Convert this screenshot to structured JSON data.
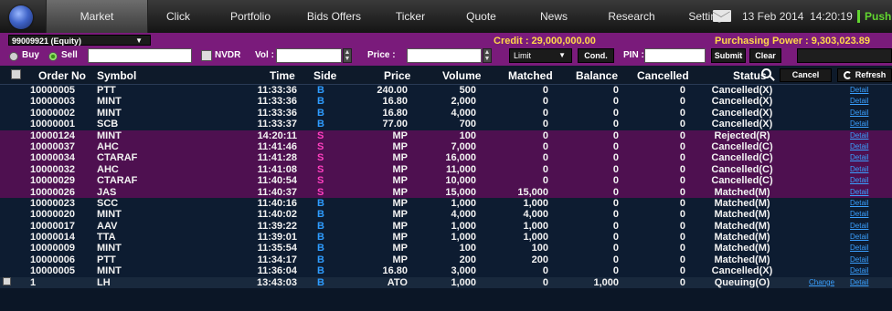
{
  "menu": [
    {
      "label": "Market",
      "active": true
    },
    {
      "label": "Click"
    },
    {
      "label": "Portfolio"
    },
    {
      "label": "Bids Offers"
    },
    {
      "label": "Ticker"
    },
    {
      "label": "Quote"
    },
    {
      "label": "News"
    },
    {
      "label": "Research"
    },
    {
      "label": "Settings"
    }
  ],
  "header": {
    "date": "13 Feb 2014",
    "time": "14:20:19",
    "push_label": "Push"
  },
  "order_bar": {
    "account": "99009921 (Equity)",
    "credit": "Credit : 29,000,000.00",
    "purchasing_power": "Purchasing Power : 9,303,023.89",
    "buy_label": "Buy",
    "sell_label": "Sell",
    "sell_selected": true,
    "symbol_value": "",
    "nvdr_label": "NVDR",
    "vol_label": "Vol :",
    "vol_value": "",
    "price_label": "Price :",
    "price_value": "",
    "order_type": "Limit",
    "cond_label": "Cond.",
    "pin_label": "PIN :",
    "pin_value": "",
    "submit_label": "Submit",
    "clear_label": "Clear"
  },
  "table": {
    "columns": {
      "order_no": "Order No",
      "symbol": "Symbol",
      "time": "Time",
      "side": "Side",
      "price": "Price",
      "volume": "Volume",
      "matched": "Matched",
      "balance": "Balance",
      "cancelled": "Cancelled",
      "status": "Status"
    },
    "cancel_label": "Cancel",
    "refresh_label": "Refresh",
    "detail_label": "Detail",
    "change_label": "Change",
    "rows": [
      {
        "order_no": "10000005",
        "symbol": "PTT",
        "time": "11:33:36",
        "side": "B",
        "price": "240.00",
        "volume": "500",
        "matched": "0",
        "balance": "0",
        "cancelled": "0",
        "status": "Cancelled(X)"
      },
      {
        "order_no": "10000003",
        "symbol": "MINT",
        "time": "11:33:36",
        "side": "B",
        "price": "16.80",
        "volume": "2,000",
        "matched": "0",
        "balance": "0",
        "cancelled": "0",
        "status": "Cancelled(X)"
      },
      {
        "order_no": "10000002",
        "symbol": "MINT",
        "time": "11:33:36",
        "side": "B",
        "price": "16.80",
        "volume": "4,000",
        "matched": "0",
        "balance": "0",
        "cancelled": "0",
        "status": "Cancelled(X)"
      },
      {
        "order_no": "10000001",
        "symbol": "SCB",
        "time": "11:33:37",
        "side": "B",
        "price": "77.00",
        "volume": "700",
        "matched": "0",
        "balance": "0",
        "cancelled": "0",
        "status": "Cancelled(X)"
      },
      {
        "order_no": "10000124",
        "symbol": "MINT",
        "time": "14:20:11",
        "side": "S",
        "price": "MP",
        "volume": "100",
        "matched": "0",
        "balance": "0",
        "cancelled": "0",
        "status": "Rejected(R)"
      },
      {
        "order_no": "10000037",
        "symbol": "AHC",
        "time": "11:41:46",
        "side": "S",
        "price": "MP",
        "volume": "7,000",
        "matched": "0",
        "balance": "0",
        "cancelled": "0",
        "status": "Cancelled(C)"
      },
      {
        "order_no": "10000034",
        "symbol": "CTARAF",
        "time": "11:41:28",
        "side": "S",
        "price": "MP",
        "volume": "16,000",
        "matched": "0",
        "balance": "0",
        "cancelled": "0",
        "status": "Cancelled(C)"
      },
      {
        "order_no": "10000032",
        "symbol": "AHC",
        "time": "11:41:08",
        "side": "S",
        "price": "MP",
        "volume": "11,000",
        "matched": "0",
        "balance": "0",
        "cancelled": "0",
        "status": "Cancelled(C)"
      },
      {
        "order_no": "10000029",
        "symbol": "CTARAF",
        "time": "11:40:54",
        "side": "S",
        "price": "MP",
        "volume": "10,000",
        "matched": "0",
        "balance": "0",
        "cancelled": "0",
        "status": "Cancelled(C)"
      },
      {
        "order_no": "10000026",
        "symbol": "JAS",
        "time": "11:40:37",
        "side": "S",
        "price": "MP",
        "volume": "15,000",
        "matched": "15,000",
        "balance": "0",
        "cancelled": "0",
        "status": "Matched(M)"
      },
      {
        "order_no": "10000023",
        "symbol": "SCC",
        "time": "11:40:16",
        "side": "B",
        "price": "MP",
        "volume": "1,000",
        "matched": "1,000",
        "balance": "0",
        "cancelled": "0",
        "status": "Matched(M)"
      },
      {
        "order_no": "10000020",
        "symbol": "MINT",
        "time": "11:40:02",
        "side": "B",
        "price": "MP",
        "volume": "4,000",
        "matched": "4,000",
        "balance": "0",
        "cancelled": "0",
        "status": "Matched(M)"
      },
      {
        "order_no": "10000017",
        "symbol": "AAV",
        "time": "11:39:22",
        "side": "B",
        "price": "MP",
        "volume": "1,000",
        "matched": "1,000",
        "balance": "0",
        "cancelled": "0",
        "status": "Matched(M)"
      },
      {
        "order_no": "10000014",
        "symbol": "TTA",
        "time": "11:39:01",
        "side": "B",
        "price": "MP",
        "volume": "1,000",
        "matched": "1,000",
        "balance": "0",
        "cancelled": "0",
        "status": "Matched(M)"
      },
      {
        "order_no": "10000009",
        "symbol": "MINT",
        "time": "11:35:54",
        "side": "B",
        "price": "MP",
        "volume": "100",
        "matched": "100",
        "balance": "0",
        "cancelled": "0",
        "status": "Matched(M)"
      },
      {
        "order_no": "10000006",
        "symbol": "PTT",
        "time": "11:34:17",
        "side": "B",
        "price": "MP",
        "volume": "200",
        "matched": "200",
        "balance": "0",
        "cancelled": "0",
        "status": "Matched(M)"
      },
      {
        "order_no": "10000005",
        "symbol": "MINT",
        "time": "11:36:04",
        "side": "B",
        "price": "16.80",
        "volume": "3,000",
        "matched": "0",
        "balance": "0",
        "cancelled": "0",
        "status": "Cancelled(X)"
      },
      {
        "order_no": "1",
        "symbol": "LH",
        "time": "13:43:03",
        "side": "B",
        "price": "ATO",
        "volume": "1,000",
        "matched": "0",
        "balance": "1,000",
        "cancelled": "0",
        "status": "Queuing(O)",
        "has_checkbox": true,
        "has_change": true
      }
    ]
  },
  "colors": {
    "order_bar_bg": "#7a1b7b",
    "sell_row_bg": "#4e1050",
    "buy_row_bg": "#0d1c31",
    "buy_side": "#2e9cff",
    "sell_side": "#ff3fc0",
    "credit_text": "#ffd84a",
    "push_green": "#62d630",
    "link_blue": "#3aa0ff"
  }
}
